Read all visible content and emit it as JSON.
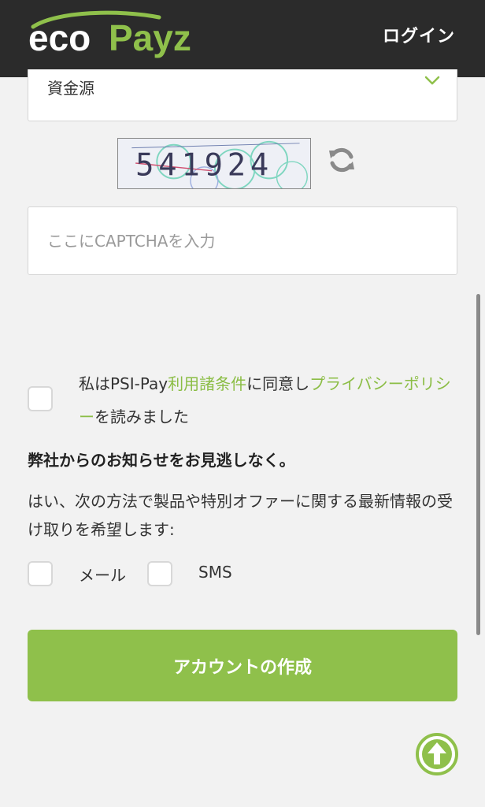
{
  "header": {
    "logo_eco": "eco",
    "logo_payz": "Payz",
    "login_label": "ログイン"
  },
  "form": {
    "funds_source_value": "資金源",
    "captcha_code": "541924",
    "captcha_placeholder": "ここにCAPTCHAを入力",
    "terms": {
      "prefix": "私はPSI-Pay",
      "terms_link": "利用諸条件",
      "middle": "に同意し",
      "privacy_link": "プライバシーポリシー",
      "suffix": "を読みました"
    },
    "notice_title": "弊社からのお知らせをお見逃しなく。",
    "notice_desc": "はい、次の方法で製品や特別オファーに関する最新情報の受け取りを希望します:",
    "email_label": "メール",
    "sms_label": "SMS",
    "create_button": "アカウントの作成"
  },
  "icons": {
    "dropdown": "chevron-down-icon",
    "refresh": "refresh-icon",
    "scroll_top": "arrow-up-circle-icon"
  },
  "colors": {
    "brand_green": "#8fc04b",
    "link_green": "#8bbd45",
    "header_bg": "#2b2b2b",
    "page_bg": "#f2f2f2"
  }
}
